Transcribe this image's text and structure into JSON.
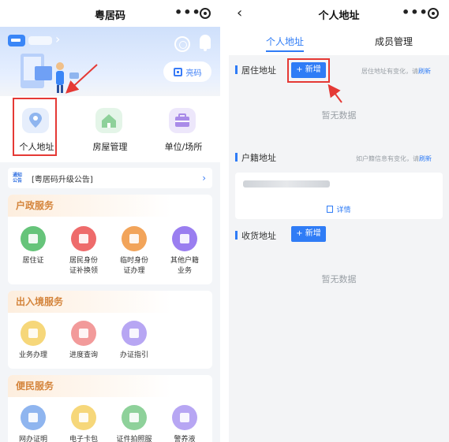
{
  "left": {
    "nav": {
      "title": "粤居码",
      "more": "•••"
    },
    "banner": {
      "scan_label": "亮码"
    },
    "quick": [
      {
        "label": "个人地址",
        "color": "#8fb5ef"
      },
      {
        "label": "房屋管理",
        "color": "#8ed19a"
      },
      {
        "label": "单位/场所",
        "color": "#a98be8"
      }
    ],
    "notice": {
      "tag_top": "通知",
      "tag_bottom": "公告",
      "text": "[粤居码升级公告]"
    },
    "sections": [
      {
        "title": "户政服务",
        "items": [
          {
            "label_1": "居住证",
            "label_2": "",
            "color": "#66c47a"
          },
          {
            "label_1": "居民身份",
            "label_2": "证补换领",
            "color": "#ee6b6b"
          },
          {
            "label_1": "临时身份",
            "label_2": "证办理",
            "color": "#f2a45a"
          },
          {
            "label_1": "其他户籍",
            "label_2": "业务",
            "color": "#9a7ef0"
          }
        ]
      },
      {
        "title": "出入境服务",
        "items": [
          {
            "label_1": "业务办理",
            "label_2": "",
            "color": "#f6d77a"
          },
          {
            "label_1": "进度查询",
            "label_2": "",
            "color": "#f29a9a"
          },
          {
            "label_1": "办证指引",
            "label_2": "",
            "color": "#b7a6f3"
          }
        ]
      },
      {
        "title": "便民服务",
        "items": [
          {
            "label_1": "网办证明",
            "label_2": "",
            "color": "#8fb5ef"
          },
          {
            "label_1": "电子卡包",
            "label_2": "",
            "color": "#f6d77a"
          },
          {
            "label_1": "证件拍照服",
            "label_2": "",
            "color": "#8ed19a"
          },
          {
            "label_1": "警养液",
            "label_2": "",
            "color": "#b7a6f3"
          }
        ]
      }
    ]
  },
  "right": {
    "nav": {
      "back": "‹",
      "title": "个人地址",
      "more": "•••"
    },
    "tabs": [
      {
        "label": "个人地址"
      },
      {
        "label": "成员管理"
      }
    ],
    "residence": {
      "title": "居住地址",
      "add_label": "+ 新增",
      "hint": "居住地址有变化，请",
      "hint_link": "刷新",
      "empty": "暂无数据"
    },
    "household": {
      "title": "户籍地址",
      "hint": "如户籍信息有变化，请",
      "hint_link": "刷新",
      "detail": "详情"
    },
    "shipping": {
      "title": "收货地址",
      "add_label": "+ 新增",
      "empty": "暂无数据"
    }
  }
}
